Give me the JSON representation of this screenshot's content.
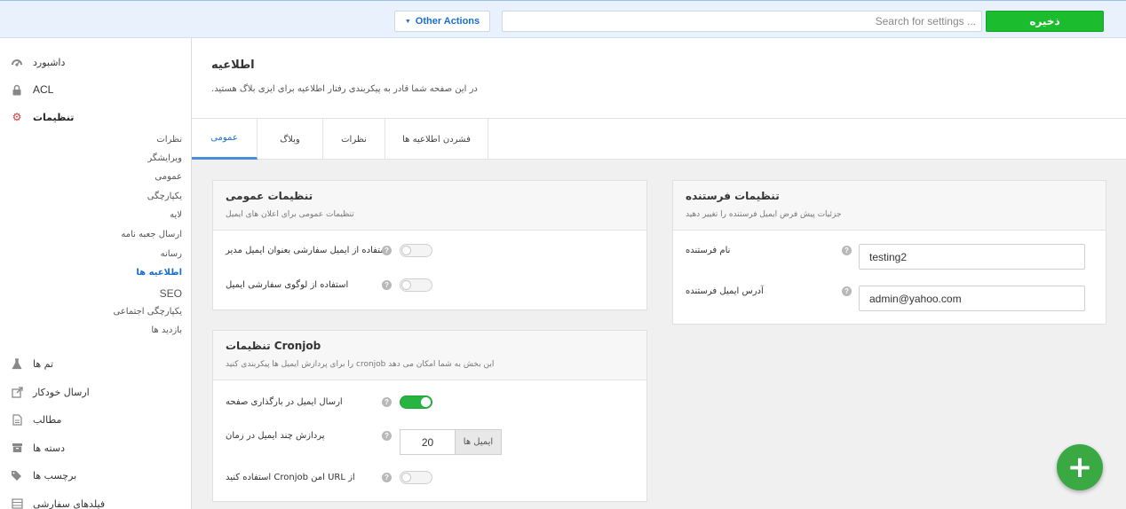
{
  "topbar": {
    "other_actions_label": "Other Actions",
    "search_placeholder": "Search for settings ...",
    "save_label": "ذخیره"
  },
  "sidebar": {
    "main_items": [
      {
        "label": "داشبورد",
        "icon": "dashboard-icon"
      },
      {
        "label": "ACL",
        "icon": "lock-icon"
      },
      {
        "label": "تنظیمات",
        "icon": "gear-icon",
        "active": true
      }
    ],
    "settings_items": [
      {
        "label": "نظرات"
      },
      {
        "label": "ویرایشگر"
      },
      {
        "label": "عمومی"
      },
      {
        "label": "یکپارچگی"
      },
      {
        "label": "لایه"
      },
      {
        "label": "ارسال جعبه نامه"
      },
      {
        "label": "رسانه"
      },
      {
        "label": "اطلاعیه ها",
        "active": true
      },
      {
        "label": "SEO"
      },
      {
        "label": "یکپارچگی اجتماعی"
      },
      {
        "label": "بازدید ها"
      }
    ],
    "bottom_items": [
      {
        "label": "تم ها",
        "icon": "flask-icon"
      },
      {
        "label": "ارسال خودکار",
        "icon": "share-icon"
      },
      {
        "label": "مطالب",
        "icon": "document-icon"
      },
      {
        "label": "دسته ها",
        "icon": "box-icon"
      },
      {
        "label": "برچسب ها",
        "icon": "tags-icon"
      },
      {
        "label": "فیلدهای سفارشی",
        "icon": "list-icon"
      }
    ]
  },
  "page": {
    "title": "اطلاعیه",
    "description": ".در این صفحه شما قادر به پیکربندی رفتار اطلاعیه برای ایزی بلاگ هستید"
  },
  "tabs": [
    {
      "label": "عمومی",
      "active": true
    },
    {
      "label": "وبلاگ"
    },
    {
      "label": "نظرات"
    },
    {
      "label": "فشردن اطلاعیه ها"
    }
  ],
  "general_panel": {
    "title": "تنظیمات عمومی",
    "subtitle": "تنظیمات عمومی برای اعلان های ایمیل",
    "rows": [
      {
        "label": "استفاده از ایمیل سفارشی بعنوان ایمیل مدیر",
        "enabled": false
      },
      {
        "label": "استفاده از لوگوی سفارشی ایمیل",
        "enabled": false
      }
    ]
  },
  "cron_panel": {
    "title": "تنظیمات Cronjob",
    "subtitle": "را برای پردازش ایمیل ها پیکربندی کنید cronjob این بخش به شما امکان می دهد",
    "rows": [
      {
        "label": "ارسال ایمیل در بارگذاری صفحه",
        "enabled": true
      },
      {
        "label": "پردازش چند ایمیل در زمان",
        "value": "20",
        "unit": "ایمیل ها"
      },
      {
        "label": "استفاده کنید Cronjob امن URL از",
        "enabled": false
      }
    ]
  },
  "sender_panel": {
    "title": "تنظیمات فرستنده",
    "subtitle": "جزئیات پیش فرض ایمیل فرستنده را تغییر دهید",
    "rows": [
      {
        "label": "نام فرستنده",
        "value": "testing2"
      },
      {
        "label": "آدرس ایمیل فرستنده",
        "value": "admin@yahoo.com"
      }
    ]
  },
  "colors": {
    "accent": "#1a6fd0",
    "save_button": "#1bbd2f",
    "toggle_on": "#27b440",
    "fab": "#3aa843"
  },
  "fab": {
    "icon": "plus-icon",
    "symbol": "+"
  }
}
